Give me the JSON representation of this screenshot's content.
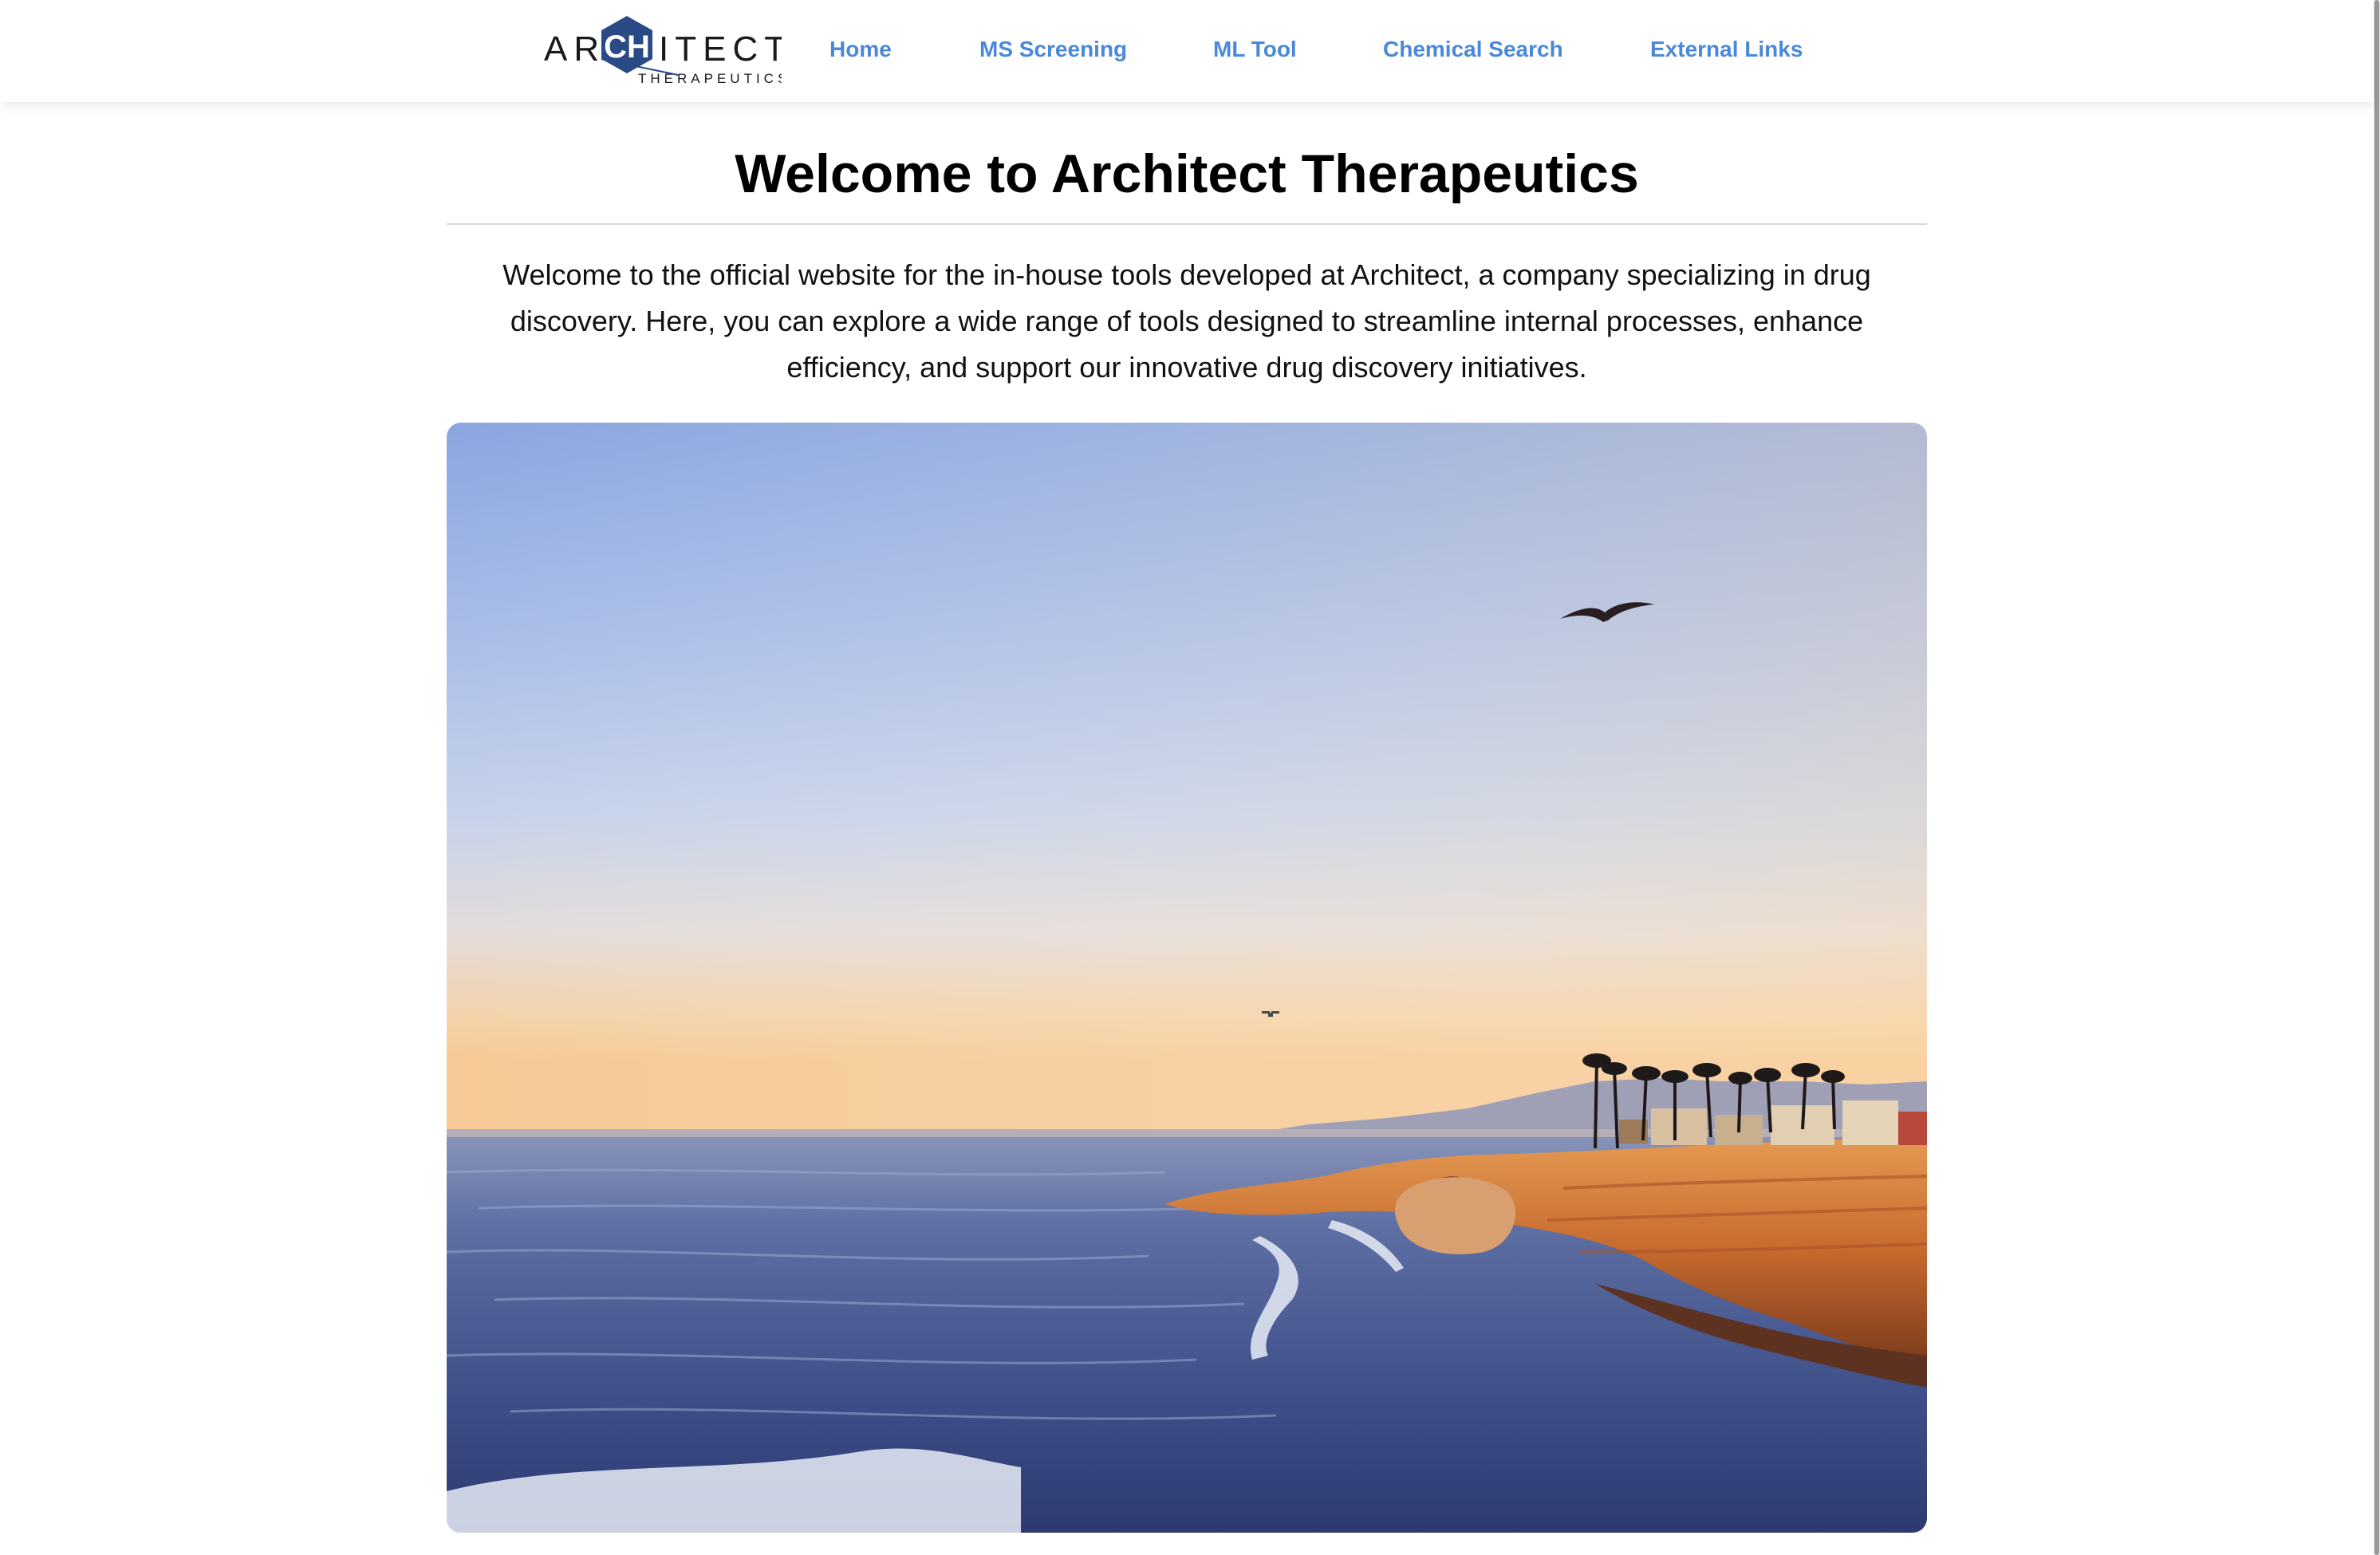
{
  "brand": {
    "logo_main": "ARCHITECT",
    "logo_sub": "THERAPEUTICS",
    "logo_hex_letters": "CH",
    "logo_color": "#2a4a86"
  },
  "nav": {
    "items": [
      {
        "label": "Home"
      },
      {
        "label": "MS Screening"
      },
      {
        "label": "ML Tool"
      },
      {
        "label": "Chemical Search"
      },
      {
        "label": "External Links"
      }
    ],
    "link_color": "#4a88d8"
  },
  "main": {
    "title": "Welcome to Architect Therapeutics",
    "intro_lines": [
      "Welcome to the official website for the in-house tools developed at Architect, a company specializing in drug",
      "discovery. Here, you can explore a wide range of tools designed to streamline internal processes, enhance",
      "efficiency, and support our innovative drug discovery initiatives."
    ]
  },
  "hero_image": {
    "subject": "coastal-sunset-cliffs-photo"
  }
}
